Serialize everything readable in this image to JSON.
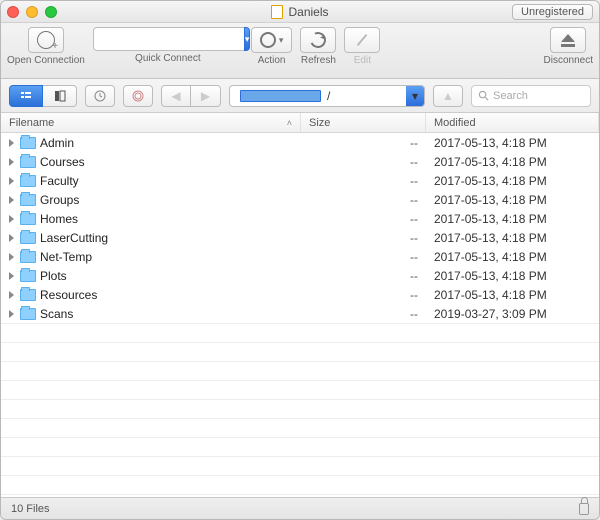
{
  "window": {
    "title": "Daniels",
    "unregistered": "Unregistered"
  },
  "toolbar": {
    "open_connection": "Open Connection",
    "quick_connect": "Quick Connect",
    "action": "Action",
    "refresh": "Refresh",
    "edit": "Edit",
    "disconnect": "Disconnect"
  },
  "path": {
    "current": "/",
    "up_disabled": true
  },
  "search": {
    "placeholder": "Search"
  },
  "columns": {
    "filename": "Filename",
    "size": "Size",
    "modified": "Modified"
  },
  "rows": [
    {
      "name": "Admin",
      "size": "--",
      "modified": "2017-05-13, 4:18 PM"
    },
    {
      "name": "Courses",
      "size": "--",
      "modified": "2017-05-13, 4:18 PM"
    },
    {
      "name": "Faculty",
      "size": "--",
      "modified": "2017-05-13, 4:18 PM"
    },
    {
      "name": "Groups",
      "size": "--",
      "modified": "2017-05-13, 4:18 PM"
    },
    {
      "name": "Homes",
      "size": "--",
      "modified": "2017-05-13, 4:18 PM"
    },
    {
      "name": "LaserCutting",
      "size": "--",
      "modified": "2017-05-13, 4:18 PM"
    },
    {
      "name": "Net-Temp",
      "size": "--",
      "modified": "2017-05-13, 4:18 PM"
    },
    {
      "name": "Plots",
      "size": "--",
      "modified": "2017-05-13, 4:18 PM"
    },
    {
      "name": "Resources",
      "size": "--",
      "modified": "2017-05-13, 4:18 PM"
    },
    {
      "name": "Scans",
      "size": "--",
      "modified": "2019-03-27, 3:09 PM"
    }
  ],
  "status": {
    "count": "10 Files"
  }
}
